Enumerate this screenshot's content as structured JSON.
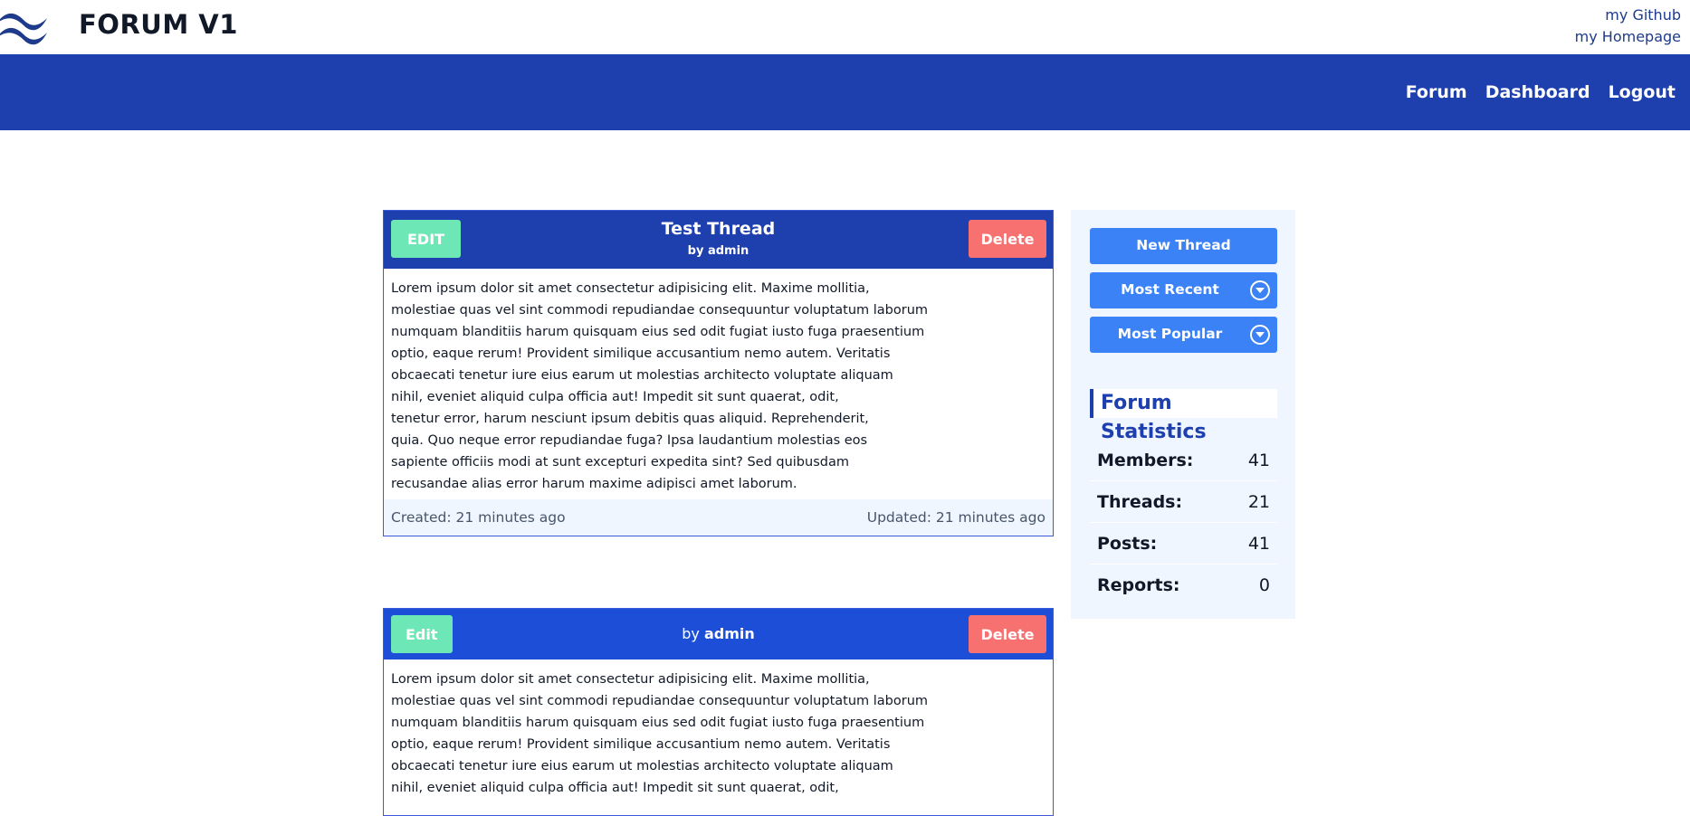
{
  "header": {
    "brand": "FORUM V1",
    "links": [
      "my Github",
      "my Homepage"
    ]
  },
  "nav": {
    "items": [
      "Forum",
      "Dashboard",
      "Logout"
    ]
  },
  "threads": [
    {
      "edit_label": "EDIT",
      "delete_label": "Delete",
      "title": "Test Thread",
      "by": "by admin",
      "body": [
        "Lorem ipsum dolor sit amet consectetur adipisicing elit. Maxime mollitia,",
        "molestiae quas vel sint commodi repudiandae consequuntur voluptatum laborum",
        "numquam blanditiis harum quisquam eius sed odit fugiat iusto fuga praesentium",
        "optio, eaque rerum! Provident similique accusantium nemo autem. Veritatis",
        "obcaecati tenetur iure eius earum ut molestias architecto voluptate aliquam",
        "nihil, eveniet aliquid culpa officia aut! Impedit sit sunt quaerat, odit,",
        "tenetur error, harum nesciunt ipsum debitis quas aliquid. Reprehenderit,",
        "quia. Quo neque error repudiandae fuga? Ipsa laudantium molestias eos",
        "sapiente officiis modi at sunt excepturi expedita sint? Sed quibusdam",
        "recusandae alias error harum maxime adipisci amet laborum."
      ],
      "created": "Created: 21 minutes ago",
      "updated": "Updated: 21 minutes ago"
    },
    {
      "edit_label": "Edit",
      "delete_label": "Delete",
      "by_prefix": "by",
      "by_user": "admin",
      "body": [
        "Lorem ipsum dolor sit amet consectetur adipisicing elit. Maxime mollitia,",
        "molestiae quas vel sint commodi repudiandae consequuntur voluptatum laborum",
        "numquam blanditiis harum quisquam eius sed odit fugiat iusto fuga praesentium",
        "optio, eaque rerum! Provident similique accusantium nemo autem. Veritatis",
        "obcaecati tenetur iure eius earum ut molestias architecto voluptate aliquam",
        "nihil, eveniet aliquid culpa officia aut! Impedit sit sunt quaerat, odit,"
      ]
    }
  ],
  "sidebar": {
    "new_thread": "New Thread",
    "most_recent": "Most Recent",
    "most_popular": "Most Popular",
    "stats_title": "Forum Statistics",
    "stats": [
      {
        "label": "Members:",
        "value": "41"
      },
      {
        "label": "Threads:",
        "value": "21"
      },
      {
        "label": "Posts:",
        "value": "41"
      },
      {
        "label": "Reports:",
        "value": "0"
      }
    ]
  },
  "colors": {
    "nav_bg": "#1e40af",
    "accent_blue": "#3b82f6",
    "edit_green": "#6ee7b7",
    "delete_red": "#f87171",
    "panel_bg": "#eff6ff"
  }
}
